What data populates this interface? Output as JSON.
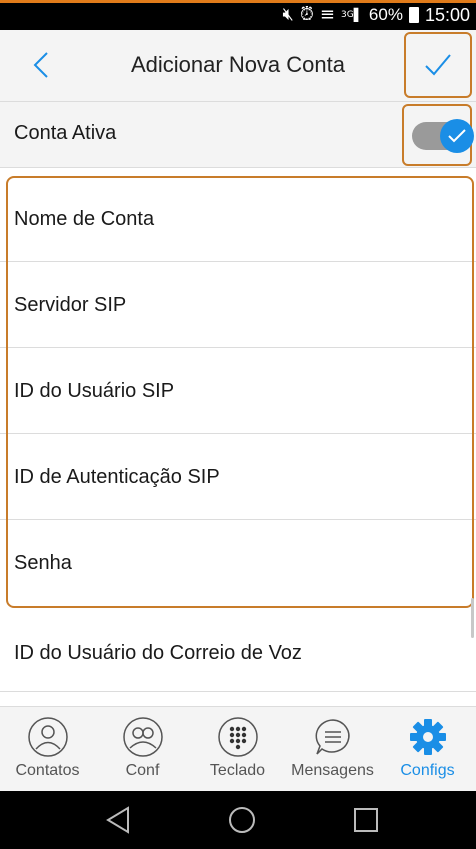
{
  "status_bar": {
    "battery": "60%",
    "time": "15:00",
    "network": "3G"
  },
  "header": {
    "title": "Adicionar Nova Conta"
  },
  "account_active": {
    "label": "Conta Ativa",
    "enabled": true
  },
  "fields": [
    {
      "label": "Nome de Conta"
    },
    {
      "label": "Servidor SIP"
    },
    {
      "label": "ID do Usuário SIP"
    },
    {
      "label": "ID de Autenticação SIP"
    },
    {
      "label": "Senha"
    },
    {
      "label": "ID do Usuário do Correio de Voz"
    }
  ],
  "bottom_nav": {
    "items": [
      {
        "label": "Contatos",
        "icon": "contact-icon"
      },
      {
        "label": "Conf",
        "icon": "conference-icon"
      },
      {
        "label": "Teclado",
        "icon": "keypad-icon"
      },
      {
        "label": "Mensagens",
        "icon": "message-icon"
      },
      {
        "label": "Configs",
        "icon": "gear-icon",
        "active": true
      }
    ]
  },
  "colors": {
    "accent": "#1a8ee6",
    "highlight_border": "#c87c2a",
    "header_bg": "#f4f4f4"
  }
}
